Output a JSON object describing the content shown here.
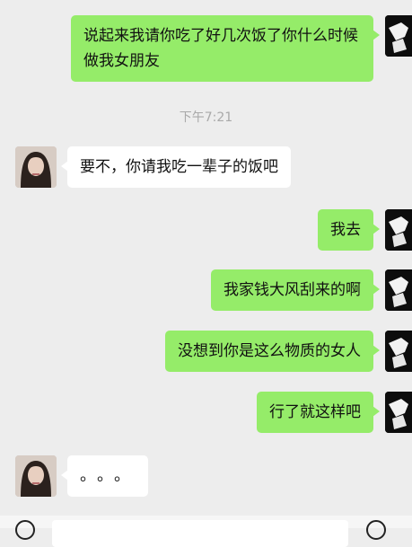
{
  "messages": [
    {
      "from": "self",
      "text": "说起来我请你吃了好几次饭了你什么时候做我女朋友"
    },
    {
      "from": "timestamp",
      "text": "下午7:21"
    },
    {
      "from": "other",
      "text": "要不，你请我吃一辈子的饭吧"
    },
    {
      "from": "self",
      "text": "我去"
    },
    {
      "from": "self",
      "text": "我家钱大风刮来的啊"
    },
    {
      "from": "self",
      "text": "没想到你是这么物质的女人"
    },
    {
      "from": "self",
      "text": "行了就这样吧"
    },
    {
      "from": "other",
      "text": "。。。"
    }
  ],
  "colors": {
    "self_bubble": "#95ec69",
    "other_bubble": "#ffffff",
    "background": "#ededed"
  }
}
